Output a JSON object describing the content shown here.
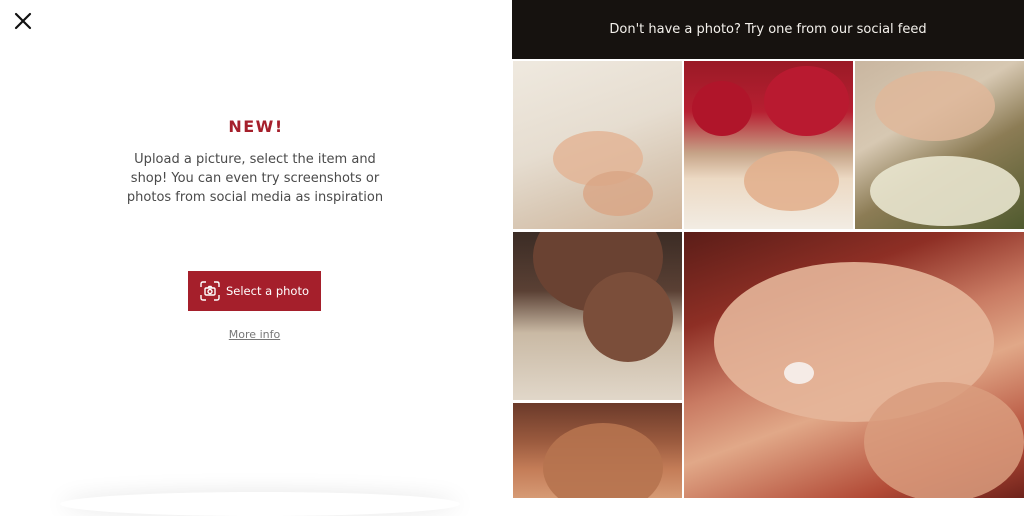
{
  "close": {
    "icon": "close-icon"
  },
  "intro": {
    "headline": "NEW!",
    "description": "Upload a picture, select the item and shop! You can even try screenshots or photos from social media as inspiration"
  },
  "actions": {
    "select_photo_label": "Select a photo",
    "select_photo_icon": "camera-scan-icon",
    "more_info_label": "More info"
  },
  "social_feed": {
    "banner_text": "Don't have a photo? Try one from our social feed"
  },
  "colors": {
    "accent": "#a51f2b",
    "banner_bg": "#16120f"
  }
}
